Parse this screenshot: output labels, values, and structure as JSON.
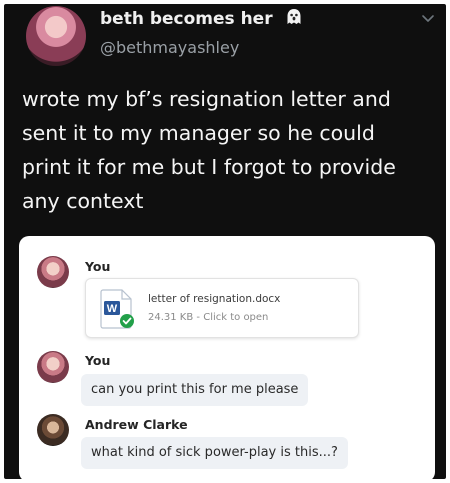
{
  "tweet": {
    "display_name": "beth becomes her",
    "handle": "@bethmayashley",
    "emoji_icon": "ghost-icon",
    "lines": [
      "wrote my bf’s resignation letter and",
      "sent it to my manager so he could",
      "print it for me but I forgot to provide",
      "any context"
    ]
  },
  "chat": {
    "messages": [
      {
        "sender": "You",
        "attachment": {
          "file_name": "letter of resignation.docx",
          "file_size": "24.31 KB",
          "separator": "-",
          "action_label": "Click to open",
          "icon": "word-doc-icon"
        }
      },
      {
        "sender": "You",
        "text": "can you print this for me please"
      },
      {
        "sender": "Andrew Clarke",
        "text": "what kind of sick power-play is this...?"
      }
    ]
  },
  "colors": {
    "background": "#0f0f0f",
    "handle": "#9aa0a6",
    "word_blue": "#2b579a",
    "check_green": "#22a04a",
    "bubble": "#eef1f5"
  }
}
